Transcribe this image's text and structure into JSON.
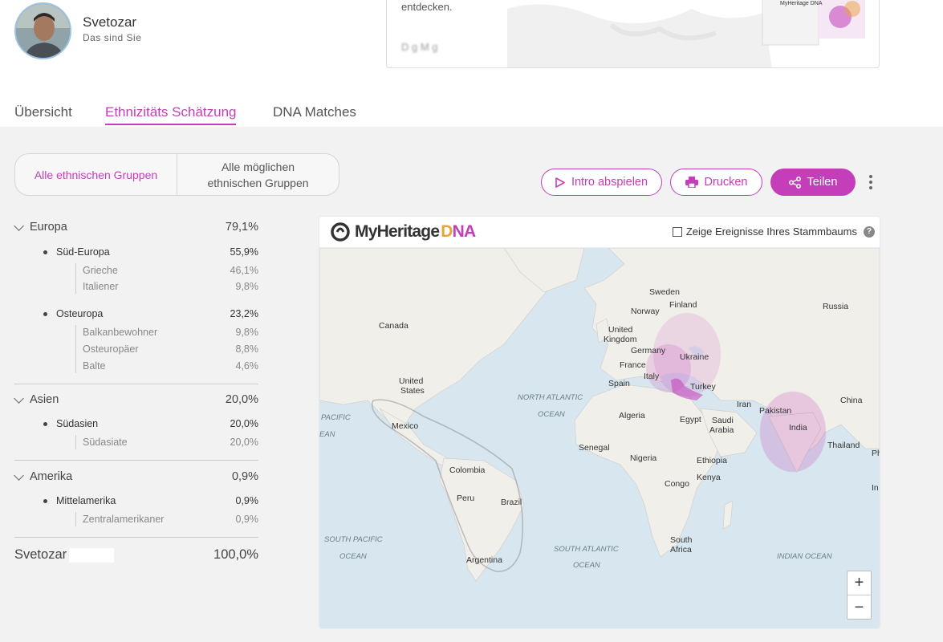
{
  "profile": {
    "name": "Svetozar",
    "subtitle": "Das sind Sie"
  },
  "promo": {
    "line1": "entdecken.",
    "line2": "D      g       M    g",
    "brand": "MyHeritage DNA"
  },
  "tabs": [
    {
      "label": "Übersicht"
    },
    {
      "label": "Ethnizitäts Schätzung"
    },
    {
      "label": "DNA Matches"
    }
  ],
  "segmented": {
    "option1": "Alle ethnischen Gruppen",
    "option2": "Alle möglichen ethnischen Gruppen"
  },
  "actions": {
    "intro": "Intro abspielen",
    "print": "Drucken",
    "share": "Teilen"
  },
  "ethnicities": {
    "europa": {
      "label": "Europa",
      "value": "79,1%"
    },
    "sued_europa": {
      "label": "Süd-Europa",
      "value": "55,9%"
    },
    "grieche": {
      "label": "Grieche",
      "value": "46,1%"
    },
    "italiener": {
      "label": "Italiener",
      "value": "9,8%"
    },
    "osteuropa": {
      "label": "Osteuropa",
      "value": "23,2%"
    },
    "balkan": {
      "label": "Balkanbewohner",
      "value": "9,8%"
    },
    "osteuropaer": {
      "label": "Osteuropäer",
      "value": "8,8%"
    },
    "balte": {
      "label": "Balte",
      "value": "4,6%"
    },
    "asien": {
      "label": "Asien",
      "value": "20,0%"
    },
    "suedasien": {
      "label": "Südasien",
      "value": "20,0%"
    },
    "suedasiate": {
      "label": "Südasiate",
      "value": "20,0%"
    },
    "amerika": {
      "label": "Amerika",
      "value": "0,9%"
    },
    "mittelamerika": {
      "label": "Mittelamerika",
      "value": "0,9%"
    },
    "zentralamerikaner": {
      "label": "Zentralamerikaner",
      "value": "0,9%"
    },
    "total": {
      "label": "Svetozar",
      "value": "100,0%"
    }
  },
  "map": {
    "logo_main": "MyHeritage",
    "logo_d": "D",
    "logo_na": "NA",
    "tree_toggle": "Zeige Ereignisse Ihres Stammbaums",
    "help": "?",
    "zoom_in": "+",
    "zoom_out": "−",
    "labels": {
      "canada": "Canada",
      "us1": "United",
      "us2": "States",
      "mexico": "Mexico",
      "colombia": "Colombia",
      "peru": "Peru",
      "brazil": "Brazil",
      "argentina": "Argentina",
      "sweden": "Sweden",
      "norway": "Norway",
      "finland": "Finland",
      "russia": "Russia",
      "uk1": "United",
      "uk2": "Kingdom",
      "germany": "Germany",
      "ukraine": "Ukraine",
      "france": "France",
      "italy": "Italy",
      "spain": "Spain",
      "turkey": "Turkey",
      "algeria": "Algeria",
      "egypt": "Egypt",
      "saudi1": "Saudi",
      "saudi2": "Arabia",
      "iran": "Iran",
      "pakistan": "Pakistan",
      "india": "India",
      "china": "China",
      "thailand": "Thailand",
      "senegal": "Senegal",
      "nigeria": "Nigeria",
      "ethiopia": "Ethiopia",
      "congo": "Congo",
      "kenya": "Kenya",
      "south1": "South",
      "south2": "Africa",
      "natl1": "NORTH ATLANTIC",
      "natl2": "OCEAN",
      "pac1": "PACIFIC",
      "pac2": "EAN",
      "spac1": "SOUTH PACIFIC",
      "spac2": "OCEAN",
      "satl1": "SOUTH ATLANTIC",
      "satl2": "OCEAN",
      "indian": "INDIAN OCEAN",
      "ph": "Ph",
      "in": "In"
    }
  },
  "colors": {
    "accent": "#c33eb8",
    "logo_orange": "#e9a33b",
    "land": "#f1efea",
    "water": "#d8e7ef"
  }
}
